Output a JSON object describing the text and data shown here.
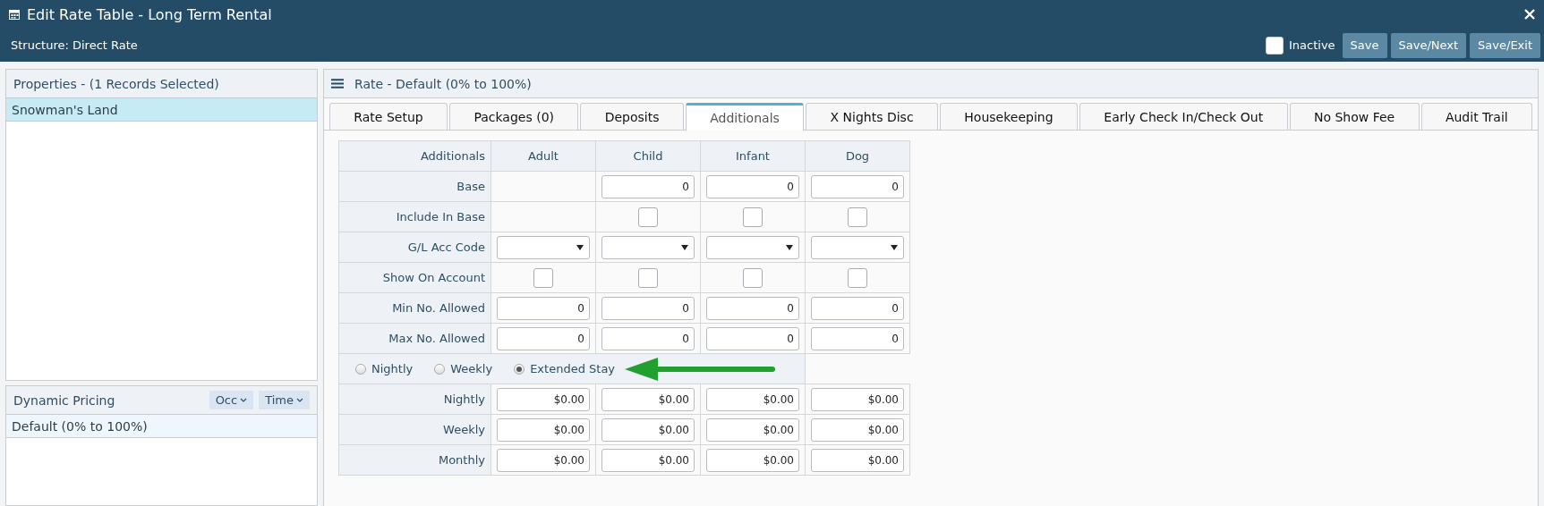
{
  "window": {
    "title": "Edit Rate Table - Long Term Rental",
    "structure": "Structure: Direct Rate",
    "inactive": {
      "label": "Inactive",
      "checked": false
    },
    "buttons": [
      "Save",
      "Save/Next",
      "Save/Exit"
    ]
  },
  "properties": {
    "title": "Properties - (1 Records Selected)",
    "items": [
      {
        "label": "Snowman's Land",
        "selected": true
      }
    ]
  },
  "dynamic_pricing": {
    "title": "Dynamic Pricing",
    "filters": [
      "Occ",
      "Time"
    ],
    "items": [
      {
        "label": "Default (0% to 100%)",
        "selected": false
      }
    ]
  },
  "rate": {
    "title": "Rate - Default (0% to 100%)",
    "tabs": [
      {
        "label": "Rate Setup",
        "selected": false
      },
      {
        "label": "Packages (0)",
        "selected": false
      },
      {
        "label": "Deposits",
        "selected": false
      },
      {
        "label": "Additionals",
        "selected": true
      },
      {
        "label": "X Nights Disc",
        "selected": false
      },
      {
        "label": "Housekeeping",
        "selected": false
      },
      {
        "label": "Early Check In/Check Out",
        "selected": false
      },
      {
        "label": "No Show Fee",
        "selected": false
      },
      {
        "label": "Audit Trail",
        "selected": false
      }
    ],
    "columns": [
      "Additionals",
      "Adult",
      "Child",
      "Infant",
      "Dog"
    ],
    "rows": [
      {
        "cells": [
          {
            "kind": "label",
            "value": "Base"
          },
          {
            "kind": "empty"
          },
          {
            "kind": "number",
            "value": "0"
          },
          {
            "kind": "number",
            "value": "0"
          },
          {
            "kind": "number",
            "value": "0"
          }
        ]
      },
      {
        "cells": [
          {
            "kind": "label",
            "value": "Include In Base"
          },
          {
            "kind": "empty"
          },
          {
            "kind": "checkbox",
            "checked": false
          },
          {
            "kind": "checkbox",
            "checked": false
          },
          {
            "kind": "checkbox",
            "checked": false
          }
        ]
      },
      {
        "cells": [
          {
            "kind": "label",
            "value": "G/L Acc Code"
          },
          {
            "kind": "select"
          },
          {
            "kind": "select"
          },
          {
            "kind": "select"
          },
          {
            "kind": "select"
          }
        ]
      },
      {
        "cells": [
          {
            "kind": "label",
            "value": "Show On Account"
          },
          {
            "kind": "checkbox",
            "checked": false
          },
          {
            "kind": "checkbox",
            "checked": false
          },
          {
            "kind": "checkbox",
            "checked": false
          },
          {
            "kind": "checkbox",
            "checked": false
          }
        ]
      },
      {
        "cells": [
          {
            "kind": "label",
            "value": "Min No. Allowed"
          },
          {
            "kind": "number",
            "value": "0"
          },
          {
            "kind": "number",
            "value": "0"
          },
          {
            "kind": "number",
            "value": "0"
          },
          {
            "kind": "number",
            "value": "0"
          }
        ]
      },
      {
        "cells": [
          {
            "kind": "label",
            "value": "Max No. Allowed"
          },
          {
            "kind": "number",
            "value": "0"
          },
          {
            "kind": "number",
            "value": "0"
          },
          {
            "kind": "number",
            "value": "0"
          },
          {
            "kind": "number",
            "value": "0"
          }
        ]
      }
    ],
    "rate_types": [
      {
        "label": "Nightly",
        "selected": false
      },
      {
        "label": "Weekly",
        "selected": false
      },
      {
        "label": "Extended Stay",
        "selected": true
      }
    ],
    "price_rows": [
      {
        "cells": [
          {
            "kind": "label",
            "value": "Nightly"
          },
          {
            "kind": "number",
            "value": "$0.00"
          },
          {
            "kind": "number",
            "value": "$0.00"
          },
          {
            "kind": "number",
            "value": "$0.00"
          },
          {
            "kind": "number",
            "value": "$0.00"
          }
        ]
      },
      {
        "cells": [
          {
            "kind": "label",
            "value": "Weekly"
          },
          {
            "kind": "number",
            "value": "$0.00"
          },
          {
            "kind": "number",
            "value": "$0.00"
          },
          {
            "kind": "number",
            "value": "$0.00"
          },
          {
            "kind": "number",
            "value": "$0.00"
          }
        ]
      },
      {
        "cells": [
          {
            "kind": "label",
            "value": "Monthly"
          },
          {
            "kind": "number",
            "value": "$0.00"
          },
          {
            "kind": "number",
            "value": "$0.00"
          },
          {
            "kind": "number",
            "value": "$0.00"
          },
          {
            "kind": "number",
            "value": "$0.00"
          }
        ]
      }
    ]
  }
}
